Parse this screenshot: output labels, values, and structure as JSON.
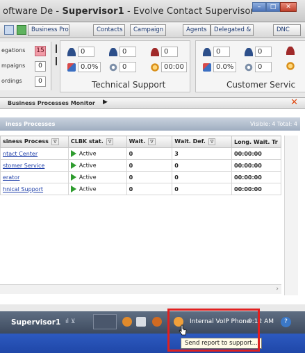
{
  "window": {
    "title_prefix": "oftware De - ",
    "title_bold": "Supervisor1",
    "title_suffix": " - Evolve Contact Supervisor"
  },
  "toolbar": {
    "tabs": [
      "Business Proc",
      "Contacts",
      "Campaign",
      "Agents",
      "Delegated &",
      "DNC"
    ]
  },
  "left_stats": [
    {
      "label": "egations",
      "value": "15",
      "alert": true
    },
    {
      "label": "mpaigns",
      "value": "0",
      "alert": false
    },
    {
      "label": "ordings",
      "value": "0",
      "alert": false
    }
  ],
  "queues": [
    {
      "name": "Technical Support",
      "row1": [
        "0",
        "0",
        "0"
      ],
      "row2": [
        "0.0%",
        "0",
        "00:00"
      ]
    },
    {
      "name": "Customer Servic",
      "row1": [
        "0",
        "0"
      ],
      "row2": [
        "0.0%",
        "0"
      ]
    }
  ],
  "monitor": {
    "title": "Business Processes Monitor",
    "group": "iness Processes",
    "visible": "Visible: 4 Total: 4"
  },
  "grid": {
    "headers": [
      "siness Process",
      "CLBK stat.",
      "Wait.",
      "Wait. Def.",
      "Long. Wait. Tr"
    ],
    "filter_label": "∇",
    "rows": [
      {
        "name": "ntact Center",
        "status": "Active",
        "wait": "0",
        "wait_def": "3",
        "long": "00:00:00"
      },
      {
        "name": "stomer Service",
        "status": "Active",
        "wait": "0",
        "wait_def": "0",
        "long": "00:00:00"
      },
      {
        "name": "erator",
        "status": "Active",
        "wait": "0",
        "wait_def": "0",
        "long": "00:00:00"
      },
      {
        "name": "hnical Support",
        "status": "Active",
        "wait": "0",
        "wait_def": "0",
        "long": "00:00:00"
      }
    ]
  },
  "statusbar": {
    "user": "Supervisor1",
    "phone": "Internal VoIP Phone",
    "time": "9:12 AM",
    "help": "?"
  },
  "tooltip": "Send report to support...",
  "colors": {
    "alert_bg": "#f19aa6",
    "status_active": "#2e9c2e",
    "highlight": "#e02020",
    "close_x": "#e04a12"
  }
}
